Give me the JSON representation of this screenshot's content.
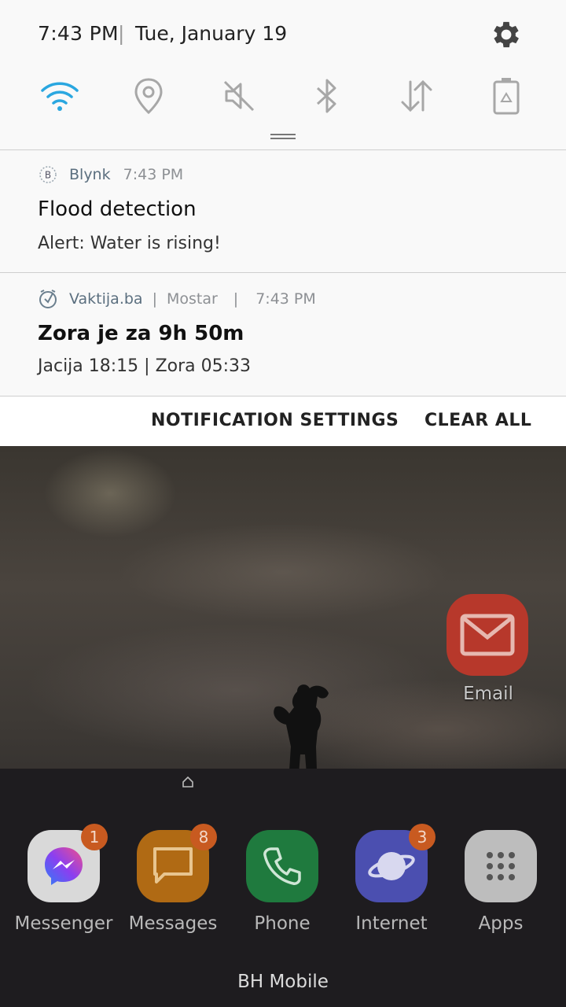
{
  "status": {
    "time": "7:43 PM",
    "separator": "|",
    "date": "Tue, January 19"
  },
  "quick_settings": [
    {
      "icon": "wifi-icon",
      "active": true
    },
    {
      "icon": "location-icon",
      "active": false
    },
    {
      "icon": "sound-mute-icon",
      "active": false
    },
    {
      "icon": "bluetooth-icon",
      "active": false
    },
    {
      "icon": "mobile-data-icon",
      "active": false
    },
    {
      "icon": "power-saving-icon",
      "active": false
    }
  ],
  "notifications": [
    {
      "app": "Blynk",
      "app_icon_letter": "B",
      "time": "7:43 PM",
      "title": "Flood detection",
      "body": "Alert: Water is rising!"
    },
    {
      "app": "Vaktija.ba",
      "location": "Mostar",
      "sep": "|",
      "time": "7:43 PM",
      "title": "Zora je za 9h 50m",
      "body": "Jacija 18:15 | Zora 05:33"
    }
  ],
  "actions": {
    "settings": "NOTIFICATION SETTINGS",
    "clear": "CLEAR ALL"
  },
  "home": {
    "email_label": "Email",
    "dock": [
      {
        "label": "Messenger",
        "badge": "1"
      },
      {
        "label": "Messages",
        "badge": "8"
      },
      {
        "label": "Phone",
        "badge": ""
      },
      {
        "label": "Internet",
        "badge": "3"
      },
      {
        "label": "Apps",
        "badge": ""
      }
    ],
    "carrier": "BH Mobile"
  },
  "colors": {
    "accent_wifi": "#2aa7e0",
    "icon_grey": "#a7a7a7",
    "badge": "#c85a20",
    "email": "#b7382b",
    "messenger": "#d9d9d9",
    "messages": "#b06a14",
    "phone": "#1f7a3e",
    "internet": "#4b4fb0",
    "apps": "#bdbdbd"
  }
}
